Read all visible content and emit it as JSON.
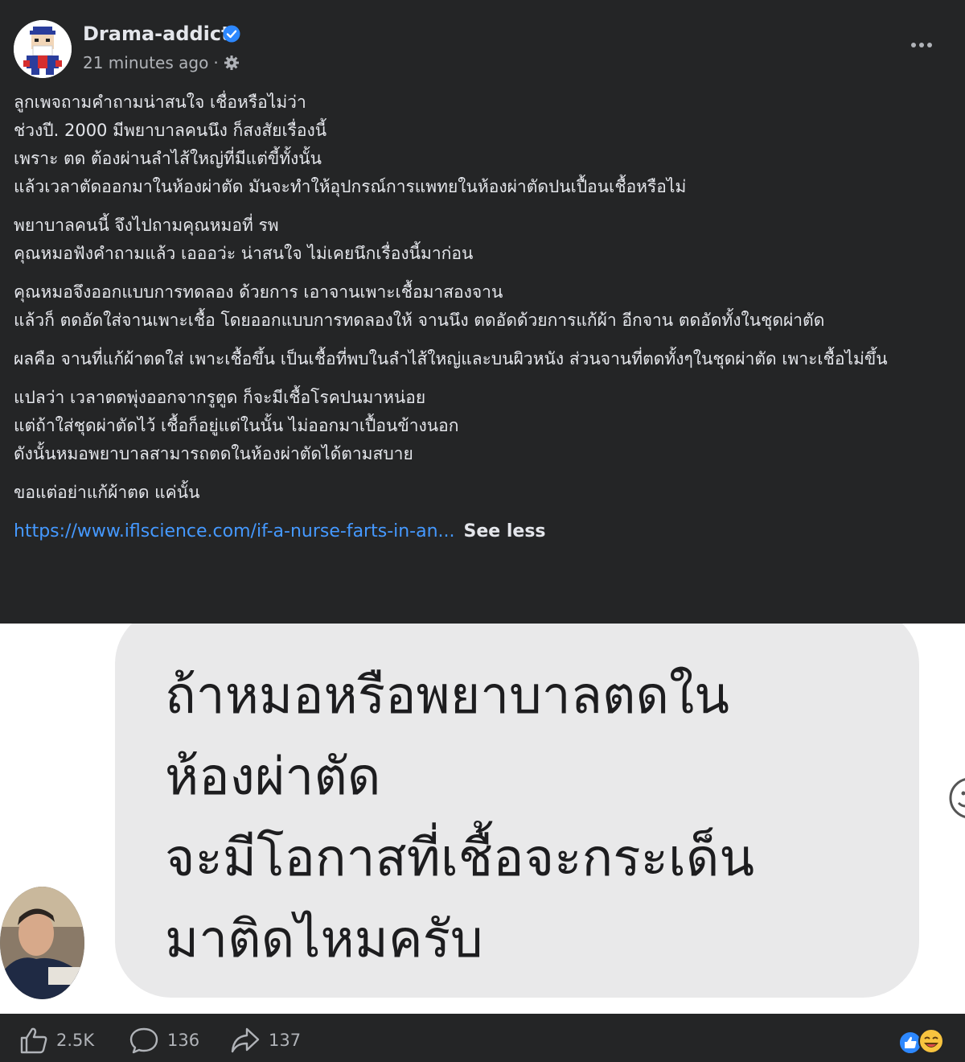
{
  "post": {
    "author": "Drama-addict",
    "time": "21 minutes ago",
    "meta_separator": "·",
    "paragraphs": [
      [
        "ลูกเพจถามคำถามน่าสนใจ เชื่อหรือไม่ว่า",
        "ช่วงปี. 2000 มีพยาบาลคนนึง ก็สงสัยเรื่องนี้",
        "เพราะ ตด ต้องผ่านลำไส้ใหญ่ที่มีแต่ขี้ทั้งนั้น",
        "แล้วเวลาตัดออกมาในห้องผ่าตัด มันจะทำให้อุปกรณ์การแพทยในห้องผ่าตัดปนเปื้อนเชื้อหรือไม่"
      ],
      [
        "พยาบาลคนนี้ จึงไปถามคุณหมอที่ รพ",
        "คุณหมอฟังคำถามแล้ว เอออว่ะ น่าสนใจ ไม่เคยนึกเรื่องนี้มาก่อน"
      ],
      [
        "คุณหมอจึงออกแบบการทดลอง  ด้วยการ เอาจานเพาะเชื้อมาสองจาน",
        "แล้วก็ ตดอัดใส่จานเพาะเชื้อ โดยออกแบบการทดลองให้ จานนึง ตดอัดด้วยการแก้ผ้า อีกจาน ตดอัดทั้งในชุดผ่าตัด"
      ],
      [
        "ผลคือ จานที่แก้ผ้าตดใส่ เพาะเชื้อขึ้น เป็นเชื้อที่พบในลำไส้ใหญ่และบนผิวหนัง ส่วนจานที่ตดทั้งๆในชุดผ่าตัด เพาะเชื้อไม่ขึ้น"
      ],
      [
        "แปลว่า เวลาตดพุ่งออกจากรูตูด ก็จะมีเชื้อโรคปนมาหน่อย",
        "แต่ถ้าใส่ชุดผ่าตัดไว้ เชื้อก็อยู่แต่ในนั้น ไม่ออกมาเปื้อนข้างนอก",
        "ดังนั้นหมอพยาบาลสามารถตดในห้องผ่าตัดได้ตามสบาย"
      ],
      [
        "ขอแต่อย่าแก้ผ้าตด แค่นั้น"
      ]
    ],
    "link": "https://www.iflscience.com/if-a-nurse-farts-in-an...",
    "see_less": "See less"
  },
  "image": {
    "lines": [
      "ถ้าหมอหรือพยาบาลตดใน",
      "ห้องผ่าตัด",
      "จะมีโอกาสที่เชื้อจะกระเด็น",
      "มาติดไหมครับ"
    ]
  },
  "footer": {
    "likes": "2.5K",
    "comments": "136",
    "shares": "137"
  },
  "colors": {
    "background": "#242526",
    "link": "#4599ff",
    "verified": "#2d88ff"
  }
}
